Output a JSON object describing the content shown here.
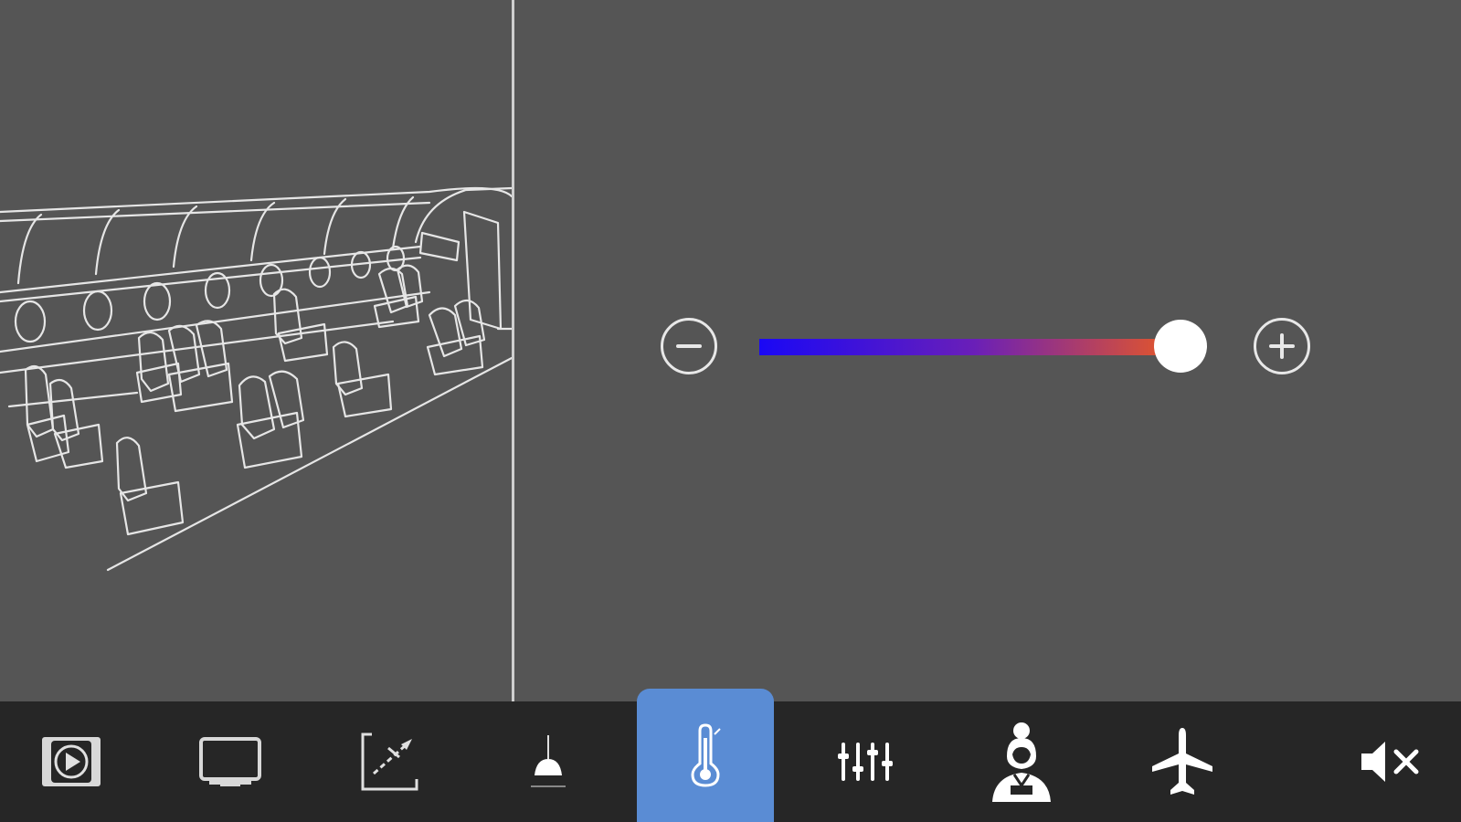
{
  "window": {
    "name": "cabin-climate-control"
  },
  "climate": {
    "temperature_level": 0.98,
    "gradient_colors": [
      "#1a08f5",
      "#6a1fb8",
      "#ee5b1c"
    ],
    "decrease_icon": "minus-circle-icon",
    "increase_icon": "plus-circle-icon"
  },
  "nav": {
    "items": [
      {
        "id": "media",
        "icon": "video-player-icon",
        "active": false
      },
      {
        "id": "display",
        "icon": "monitor-icon",
        "active": false
      },
      {
        "id": "window-shade",
        "icon": "window-shade-icon",
        "active": false
      },
      {
        "id": "lighting",
        "icon": "ceiling-lamp-icon",
        "active": false
      },
      {
        "id": "climate",
        "icon": "thermometer-icon",
        "active": true
      },
      {
        "id": "audio",
        "icon": "sliders-icon",
        "active": false
      },
      {
        "id": "attendant",
        "icon": "flight-attendant-icon",
        "active": false
      },
      {
        "id": "flight",
        "icon": "airplane-icon",
        "active": false
      },
      {
        "id": "mute",
        "icon": "speaker-muted-icon",
        "active": false
      }
    ],
    "active_color": "#5a8cd4",
    "bar_color": "#262626"
  }
}
